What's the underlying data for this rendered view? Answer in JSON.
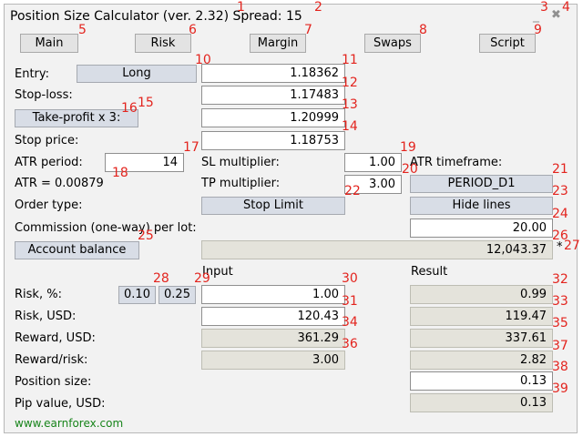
{
  "window": {
    "title": "Position Size Calculator (ver. 2.32) Spread: 15",
    "minimize_glyph": "_",
    "close_glyph": "✖"
  },
  "tabs": [
    "Main",
    "Risk",
    "Margin",
    "Swaps",
    "Script"
  ],
  "rows": {
    "entry_label": "Entry:",
    "entry_type_button": "Long",
    "entry_value": "1.18362",
    "stoploss_label": "Stop-loss:",
    "stoploss_value": "1.17483",
    "takeprofit_button": "Take-profit x 3:",
    "takeprofit_value": "1.20999",
    "stopprice_label": "Stop price:",
    "stopprice_value": "1.18753",
    "atr_period_label": "ATR period:",
    "atr_period_value": "14",
    "sl_multiplier_label": "SL multiplier:",
    "sl_multiplier_value": "1.00",
    "atr_timeframe_label": "ATR timeframe:",
    "atr_value_label": "ATR = 0.00879",
    "tp_multiplier_label": "TP multiplier:",
    "tp_multiplier_value": "3.00",
    "atr_timeframe_button": "PERIOD_D1",
    "order_type_label": "Order type:",
    "order_type_button": "Stop Limit",
    "hide_lines_button": "Hide lines",
    "commission_label": "Commission (one-way) per lot:",
    "commission_value": "20.00",
    "account_balance_button": "Account balance",
    "account_balance_value": "12,043.37",
    "account_balance_suffix": "*"
  },
  "results": {
    "input_header": "Input",
    "result_header": "Result",
    "risk_pct_label": "Risk, %:",
    "risk_pct_preset_1": "0.10",
    "risk_pct_preset_2": "0.25",
    "risk_pct_input": "1.00",
    "risk_pct_result": "0.99",
    "risk_usd_label": "Risk, USD:",
    "risk_usd_input": "120.43",
    "risk_usd_result": "119.47",
    "reward_usd_label": "Reward, USD:",
    "reward_usd_input": "361.29",
    "reward_usd_result": "337.61",
    "reward_risk_label": "Reward/risk:",
    "reward_risk_input": "3.00",
    "reward_risk_result": "2.82",
    "position_size_label": "Position size:",
    "position_size_result": "0.13",
    "pip_value_label": "Pip value, USD:",
    "pip_value_result": "0.13"
  },
  "footer": {
    "link": "www.earnforex.com"
  },
  "markers": [
    "1",
    "2",
    "3",
    "4",
    "5",
    "6",
    "7",
    "8",
    "9",
    "10",
    "11",
    "12",
    "13",
    "14",
    "15",
    "16",
    "17",
    "18",
    "19",
    "20",
    "21",
    "22",
    "23",
    "24",
    "25",
    "26",
    "27",
    "28",
    "29",
    "30",
    "31",
    "32",
    "33",
    "34",
    "35",
    "36",
    "37",
    "38",
    "39"
  ]
}
